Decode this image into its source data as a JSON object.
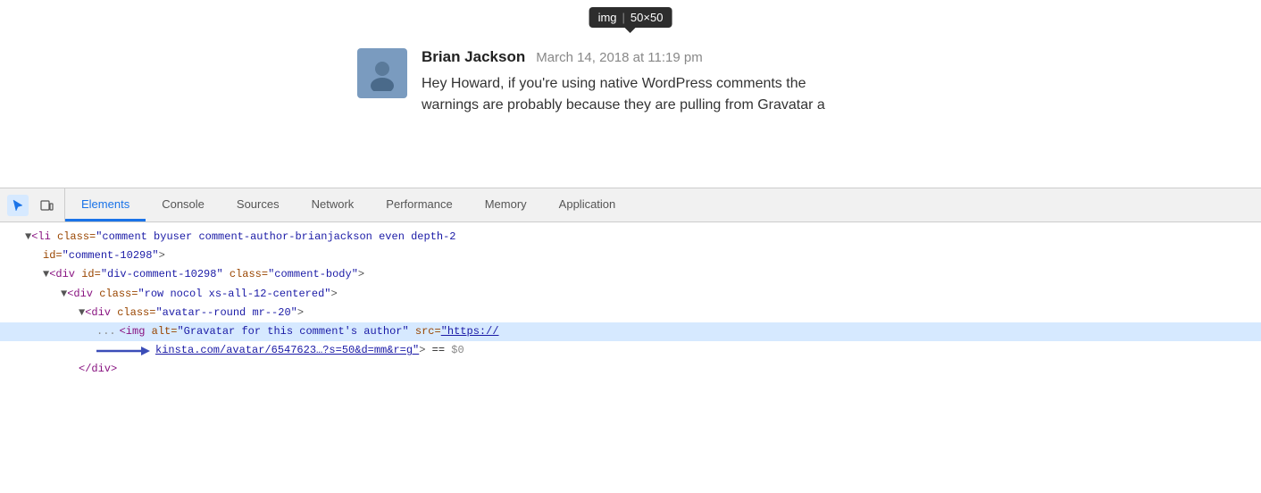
{
  "tooltip": {
    "tag": "img",
    "dimensions": "50×50"
  },
  "comment": {
    "author": "Brian Jackson",
    "date": "March 14, 2018 at 11:19 pm",
    "text_line1": "Hey Howard, if you're using native WordPress comments the",
    "text_line2": "warnings are probably because they are pulling from Gravatar a"
  },
  "devtools": {
    "tabs": [
      {
        "label": "Elements",
        "active": true
      },
      {
        "label": "Console",
        "active": false
      },
      {
        "label": "Sources",
        "active": false
      },
      {
        "label": "Network",
        "active": false
      },
      {
        "label": "Performance",
        "active": false
      },
      {
        "label": "Memory",
        "active": false
      },
      {
        "label": "Application",
        "active": false
      }
    ],
    "html_lines": [
      {
        "indent": "indent1",
        "content_html": "<span class='tag-name'>&lt;li</span> <span class='attr-name'>class=</span><span class='attr-value'>\"comment byuser comment-author-brianjackson even depth-2</span>",
        "highlighted": false
      },
      {
        "indent": "indent2",
        "content_html": "<span class='attr-name'>id=</span><span class='attr-value'>\"comment-10298\"</span><span class='bracket'>&gt;</span>",
        "highlighted": false
      },
      {
        "indent": "indent2",
        "content_html": "<span class='bracket'>▼</span><span class='tag-name'>&lt;div</span> <span class='attr-name'>id=</span><span class='attr-value'>\"div-comment-10298\"</span> <span class='attr-name'>class=</span><span class='attr-value'>\"comment-body\"</span><span class='bracket'>&gt;</span>",
        "highlighted": false
      },
      {
        "indent": "indent3",
        "content_html": "<span class='bracket'>▼</span><span class='tag-name'>&lt;div</span> <span class='attr-name'>class=</span><span class='attr-value'>\"row nocol xs-all-12-centered\"</span><span class='bracket'>&gt;</span>",
        "highlighted": false
      },
      {
        "indent": "indent4",
        "content_html": "<span class='bracket'>▼</span><span class='tag-name'>&lt;div</span> <span class='attr-name'>class=</span><span class='attr-value'>\"avatar--round mr--20\"</span><span class='bracket'>&gt;</span>",
        "highlighted": false
      },
      {
        "indent": "indent5",
        "content_html": "<span class='tag-name'>&lt;img</span> <span class='attr-name'>alt=</span><span class='attr-value'>\"Gravatar for this comment's author\"</span> <span class='attr-name'>src=</span><span class='line-blue-link'>\"https://</span>",
        "highlighted": true,
        "has_sidebar": false
      },
      {
        "indent": "indent5",
        "content_html": "<span class='line-blue-link'>kinsta.com/avatar/6547623…?s=50&d=mm&r=g\"</span><span class='bracket'>&gt;</span> <span class='equals-sign'>==</span> <span class='dollar-zero'>$0</span>",
        "highlighted": false,
        "has_arrow": true
      },
      {
        "indent": "indent4",
        "content_html": "<span class='tag-name'>&lt;/div&gt;</span>",
        "highlighted": false
      }
    ]
  }
}
